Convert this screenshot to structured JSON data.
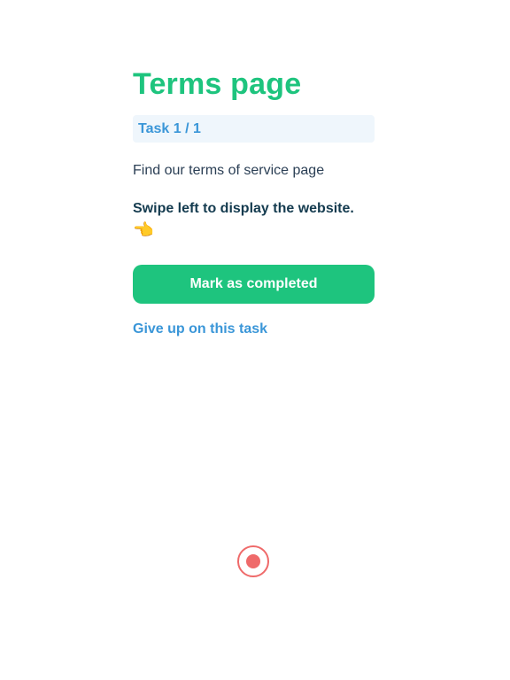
{
  "task": {
    "title": "Terms page",
    "progress_label": "Task 1 / 1",
    "instruction": "Find our terms of service page",
    "hint": "Swipe left to display the website.",
    "hint_icon": "pointing-left-hand-emoji",
    "hint_emoji": "👈"
  },
  "actions": {
    "complete_label": "Mark as completed",
    "give_up_label": "Give up on this task"
  },
  "record": {
    "icon": "record-icon",
    "color": "#ef6a6a"
  },
  "colors": {
    "accent": "#1ec47e",
    "link": "#3a96d8",
    "badge_bg": "#eff6fc",
    "hint_text": "#143b4f"
  }
}
